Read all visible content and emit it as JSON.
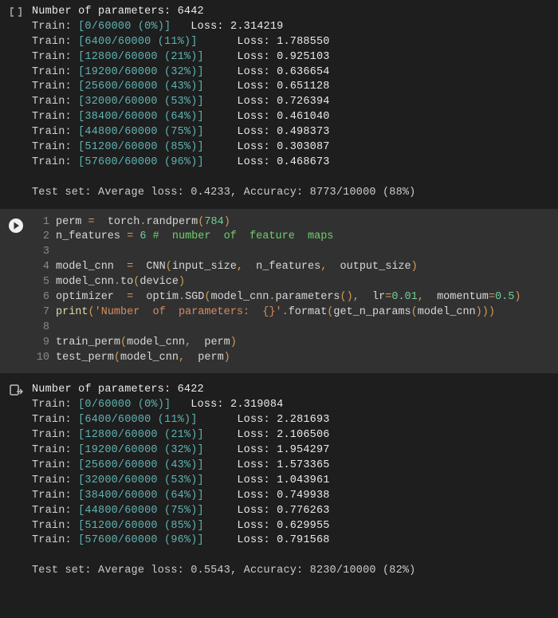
{
  "output1": {
    "header": "Number of parameters: 6442",
    "lines": [
      "Train: [0/60000 (0%)]   Loss: 2.314219",
      "Train: [6400/60000 (11%)]      Loss: 1.788550",
      "Train: [12800/60000 (21%)]     Loss: 0.925103",
      "Train: [19200/60000 (32%)]     Loss: 0.636654",
      "Train: [25600/60000 (43%)]     Loss: 0.651128",
      "Train: [32000/60000 (53%)]     Loss: 0.726394",
      "Train: [38400/60000 (64%)]     Loss: 0.461040",
      "Train: [44800/60000 (75%)]     Loss: 0.498373",
      "Train: [51200/60000 (85%)]     Loss: 0.303087",
      "Train: [57600/60000 (96%)]     Loss: 0.468673"
    ],
    "summary": "Test set: Average loss: 0.4233, Accuracy: 8773/10000 (88%)"
  },
  "code": {
    "lines": [
      {
        "n": 1,
        "tokens": [
          {
            "t": "perm ",
            "c": "tok-var"
          },
          {
            "t": "=",
            "c": "tok-op"
          },
          {
            "t": "  torch",
            "c": "tok-var"
          },
          {
            "t": ".",
            "c": "tok-op"
          },
          {
            "t": "randperm",
            "c": "tok-var"
          },
          {
            "t": "(",
            "c": "tok-op"
          },
          {
            "t": "784",
            "c": "tok-num"
          },
          {
            "t": ")",
            "c": "tok-op"
          }
        ]
      },
      {
        "n": 2,
        "tokens": [
          {
            "t": "n_features ",
            "c": "tok-var"
          },
          {
            "t": "=",
            "c": "tok-op"
          },
          {
            "t": " ",
            "c": "tok-var"
          },
          {
            "t": "6",
            "c": "tok-num"
          },
          {
            "t": " ",
            "c": "tok-var"
          },
          {
            "t": "#  number  of  feature  maps",
            "c": "tok-comment"
          }
        ]
      },
      {
        "n": 3,
        "tokens": [
          {
            "t": "",
            "c": "tok-var"
          }
        ]
      },
      {
        "n": 4,
        "tokens": [
          {
            "t": "model_cnn  ",
            "c": "tok-var"
          },
          {
            "t": "=",
            "c": "tok-op"
          },
          {
            "t": "  CNN",
            "c": "tok-var"
          },
          {
            "t": "(",
            "c": "tok-op"
          },
          {
            "t": "input_size",
            "c": "tok-var"
          },
          {
            "t": ",",
            "c": "tok-op"
          },
          {
            "t": "  n_features",
            "c": "tok-var"
          },
          {
            "t": ",",
            "c": "tok-op"
          },
          {
            "t": "  output_size",
            "c": "tok-var"
          },
          {
            "t": ")",
            "c": "tok-op"
          }
        ]
      },
      {
        "n": 5,
        "tokens": [
          {
            "t": "model_cnn",
            "c": "tok-var"
          },
          {
            "t": ".",
            "c": "tok-op"
          },
          {
            "t": "to",
            "c": "tok-var"
          },
          {
            "t": "(",
            "c": "tok-op"
          },
          {
            "t": "device",
            "c": "tok-var"
          },
          {
            "t": ")",
            "c": "tok-op"
          }
        ]
      },
      {
        "n": 6,
        "tokens": [
          {
            "t": "optimizer  ",
            "c": "tok-var"
          },
          {
            "t": "=",
            "c": "tok-op"
          },
          {
            "t": "  optim",
            "c": "tok-var"
          },
          {
            "t": ".",
            "c": "tok-op"
          },
          {
            "t": "SGD",
            "c": "tok-var"
          },
          {
            "t": "(",
            "c": "tok-op"
          },
          {
            "t": "model_cnn",
            "c": "tok-var"
          },
          {
            "t": ".",
            "c": "tok-op"
          },
          {
            "t": "parameters",
            "c": "tok-var"
          },
          {
            "t": "(),",
            "c": "tok-op"
          },
          {
            "t": "  lr",
            "c": "tok-var"
          },
          {
            "t": "=",
            "c": "tok-op"
          },
          {
            "t": "0.01",
            "c": "tok-num"
          },
          {
            "t": ",",
            "c": "tok-op"
          },
          {
            "t": "  momentum",
            "c": "tok-var"
          },
          {
            "t": "=",
            "c": "tok-op"
          },
          {
            "t": "0.5",
            "c": "tok-num"
          },
          {
            "t": ")",
            "c": "tok-op"
          }
        ]
      },
      {
        "n": 7,
        "tokens": [
          {
            "t": "print",
            "c": "tok-call"
          },
          {
            "t": "(",
            "c": "tok-op"
          },
          {
            "t": "'Number  of  parameters:  {}'",
            "c": "tok-string"
          },
          {
            "t": ".",
            "c": "tok-op"
          },
          {
            "t": "format",
            "c": "tok-var"
          },
          {
            "t": "(",
            "c": "tok-op"
          },
          {
            "t": "get_n_params",
            "c": "tok-var"
          },
          {
            "t": "(",
            "c": "tok-op"
          },
          {
            "t": "model_cnn",
            "c": "tok-var"
          },
          {
            "t": ")))",
            "c": "tok-op"
          }
        ]
      },
      {
        "n": 8,
        "tokens": [
          {
            "t": "",
            "c": "tok-var"
          }
        ]
      },
      {
        "n": 9,
        "tokens": [
          {
            "t": "train_perm",
            "c": "tok-var"
          },
          {
            "t": "(",
            "c": "tok-op"
          },
          {
            "t": "model_cnn",
            "c": "tok-var"
          },
          {
            "t": ",",
            "c": "tok-op"
          },
          {
            "t": "  perm",
            "c": "tok-var"
          },
          {
            "t": ")",
            "c": "tok-op"
          }
        ]
      },
      {
        "n": 10,
        "tokens": [
          {
            "t": "test_perm",
            "c": "tok-var"
          },
          {
            "t": "(",
            "c": "tok-op"
          },
          {
            "t": "model_cnn",
            "c": "tok-var"
          },
          {
            "t": ",",
            "c": "tok-op"
          },
          {
            "t": "  perm",
            "c": "tok-var"
          },
          {
            "t": ")",
            "c": "tok-op"
          }
        ]
      }
    ]
  },
  "output2": {
    "header": "Number of parameters: 6422",
    "lines": [
      "Train: [0/60000 (0%)]   Loss: 2.319084",
      "Train: [6400/60000 (11%)]      Loss: 2.281693",
      "Train: [12800/60000 (21%)]     Loss: 2.106506",
      "Train: [19200/60000 (32%)]     Loss: 1.954297",
      "Train: [25600/60000 (43%)]     Loss: 1.573365",
      "Train: [32000/60000 (53%)]     Loss: 1.043961",
      "Train: [38400/60000 (64%)]     Loss: 0.749938",
      "Train: [44800/60000 (75%)]     Loss: 0.776263",
      "Train: [51200/60000 (85%)]     Loss: 0.629955",
      "Train: [57600/60000 (96%)]     Loss: 0.791568"
    ],
    "summary": "Test set: Average loss: 0.5543, Accuracy: 8230/10000 (82%)"
  }
}
